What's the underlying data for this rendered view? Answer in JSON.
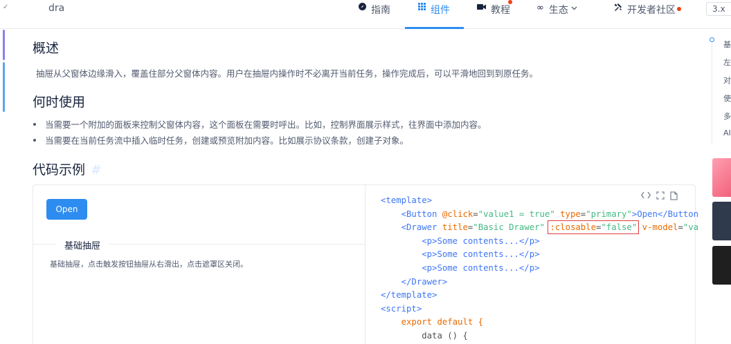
{
  "nav": {
    "search_text": "dra",
    "items": [
      {
        "label": "指南",
        "icon": "compass-icon"
      },
      {
        "label": "组件",
        "icon": "grid-icon"
      },
      {
        "label": "教程",
        "icon": "video-icon"
      },
      {
        "label": "生态",
        "icon": "infinity-icon"
      },
      {
        "label": "开发者社区",
        "icon": "tools-icon"
      }
    ],
    "version": "3.x"
  },
  "content": {
    "overview_title": "概述",
    "overview_text": "抽屉从父窗体边缘滑入，覆盖住部分父窗体内容。用户在抽屉内操作时不必离开当前任务，操作完成后，可以平滑地回到到原任务。",
    "when_title": "何时使用",
    "when_items": [
      "当需要一个附加的面板来控制父窗体内容，这个面板在需要时呼出。比如，控制界面展示样式，往界面中添加内容。",
      "当需要在当前任务流中插入临时任务，创建或预览附加内容。比如展示协议条款，创建子对象。"
    ],
    "examples_title": "代码示例",
    "anchor": "#"
  },
  "demo": {
    "button_label": "Open",
    "title": "基础抽屉",
    "description": "基础抽屉，点击触发按钮抽屉从右滑出，点击遮罩区关闭。"
  },
  "code": {
    "l1": "<template>",
    "l2_tag": "<Button",
    "l2_attr1": "@click",
    "l2_val1": "\"value1 = true\"",
    "l2_attr2": "type",
    "l2_val2": "\"primary\"",
    "l2_text": ">Open</Button",
    "l3_tag": "<Drawer",
    "l3_attr1": "title",
    "l3_val1": "\"Basic Drawer\"",
    "l3_attr2": ":closable",
    "l3_val2": "\"false\"",
    "l3_attr3": "v-model",
    "l3_val3": "\"va",
    "l4": "<p>Some contents...</p>",
    "l7": "</Drawer>",
    "l8": "</template>",
    "l9": "<script>",
    "l10": "export default {",
    "l11": "data () {"
  },
  "toc": [
    "基",
    "左",
    "对",
    "使",
    "多",
    "AI"
  ],
  "colors": {
    "accent": "#2d8cf0",
    "highlight_box": "#e03b3b"
  }
}
